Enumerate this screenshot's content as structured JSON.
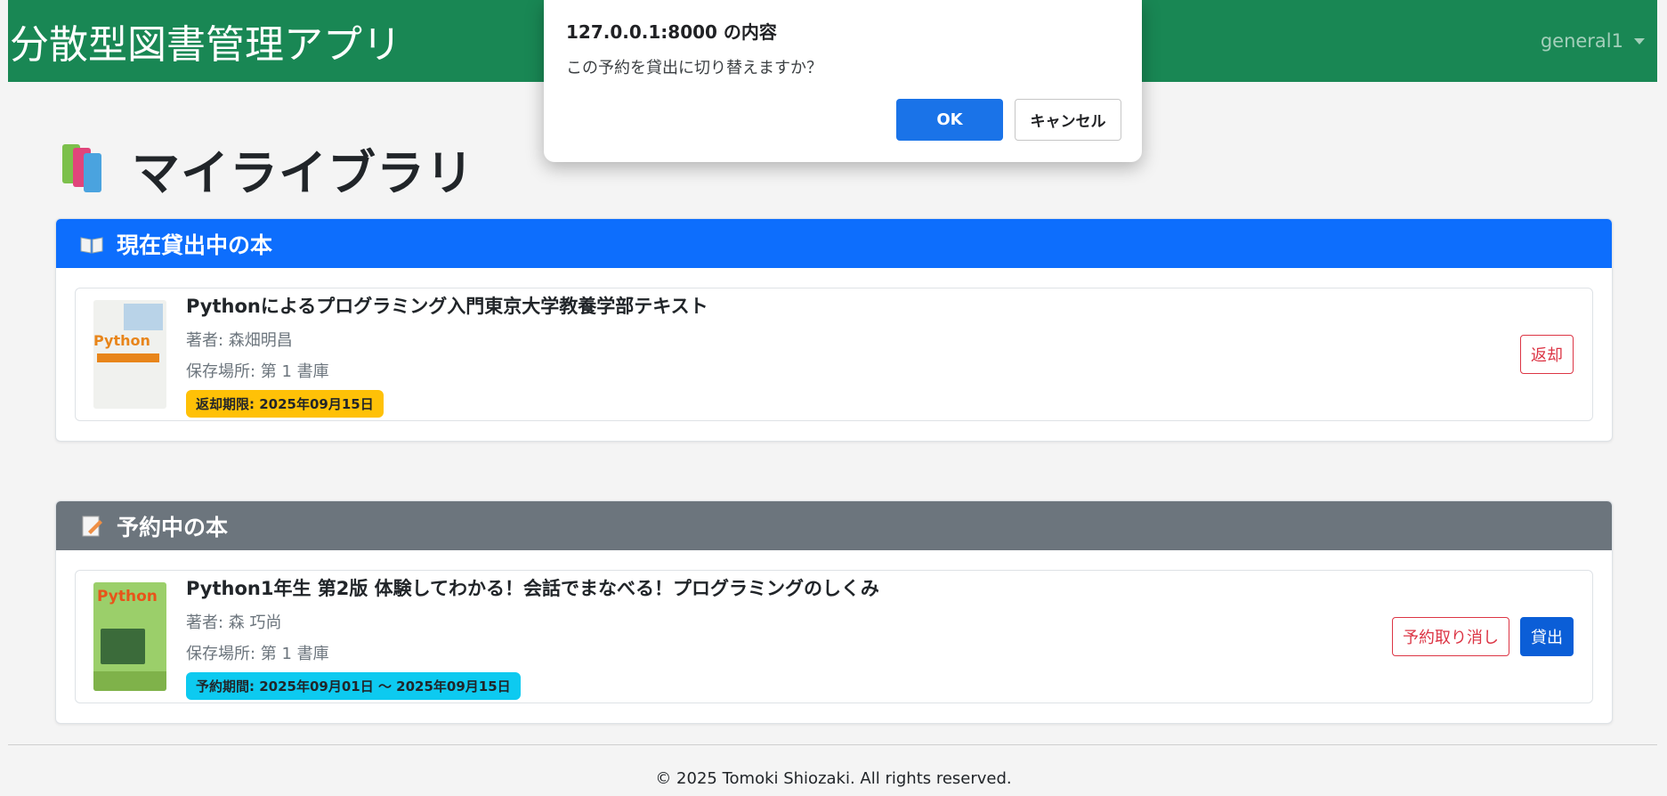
{
  "navbar": {
    "brand": "分散型図書管理アプリ",
    "user": "general1"
  },
  "page": {
    "title": "マイライブラリ"
  },
  "lending": {
    "header": "現在貸出中の本",
    "book": {
      "title": "Pythonによるプログラミング入門東京大学教養学部テキスト",
      "author": "著者: 森畑明昌",
      "location": "保存場所: 第 1 書庫",
      "due": "返却期限: 2025年09月15日",
      "return_label": "返却",
      "cover_text": "Python"
    }
  },
  "reserved": {
    "header": "予約中の本",
    "book": {
      "title": "Python1年生 第2版 体験してわかる！会話でまなべる！プログラミングのしくみ",
      "author": "著者: 森 巧尚",
      "location": "保存場所: 第 1 書庫",
      "period": "予約期間: 2025年09月01日 〜 2025年09月15日",
      "cancel_label": "予約取り消し",
      "lend_label": "貸出",
      "cover_text": "Python"
    }
  },
  "footer": {
    "text": "© 2025 Tomoki Shiozaki. All rights reserved."
  },
  "dialog": {
    "title": "127.0.0.1:8000 の内容",
    "message": "この予約を貸出に切り替えますか？",
    "ok_label": "OK",
    "cancel_label": "キャンセル"
  },
  "colors": {
    "navbar": "#198754",
    "lending_header": "#0d6efd",
    "reserved_header": "#6c757d",
    "due_badge": "#ffc107",
    "period_badge": "#0dcaf0",
    "dialog_ok": "#1a73e8"
  }
}
